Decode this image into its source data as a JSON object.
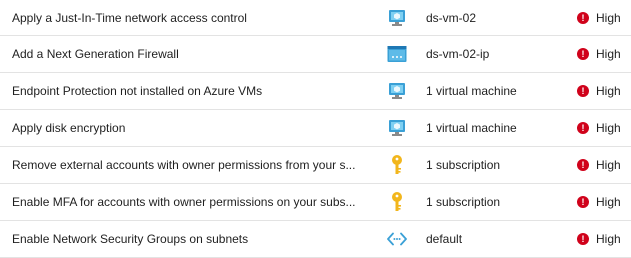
{
  "colors": {
    "high_severity": "#d0021b",
    "vm_icon": "#3aa0d6",
    "key_icon": "#f2b61c",
    "vnet_icon": "#3aa0d6",
    "row_divider": "#e3e3e3"
  },
  "recommendations": [
    {
      "title": "Apply a Just-In-Time network access control",
      "resource_icon": "virtual-machine-icon",
      "resource": "ds-vm-02",
      "severity": "High"
    },
    {
      "title": "Add a Next Generation Firewall",
      "resource_icon": "public-ip-icon",
      "resource": "ds-vm-02-ip",
      "severity": "High"
    },
    {
      "title": "Endpoint Protection not installed on Azure VMs",
      "resource_icon": "virtual-machine-icon",
      "resource": "1 virtual machine",
      "severity": "High"
    },
    {
      "title": "Apply disk encryption",
      "resource_icon": "virtual-machine-icon",
      "resource": "1 virtual machine",
      "severity": "High"
    },
    {
      "title": "Remove external accounts with owner permissions from your s...",
      "resource_icon": "key-icon",
      "resource": "1 subscription",
      "severity": "High"
    },
    {
      "title": "Enable MFA for accounts with owner permissions on your subs...",
      "resource_icon": "key-icon",
      "resource": "1 subscription",
      "severity": "High"
    },
    {
      "title": "Enable Network Security Groups on subnets",
      "resource_icon": "virtual-network-icon",
      "resource": "default",
      "severity": "High"
    }
  ]
}
